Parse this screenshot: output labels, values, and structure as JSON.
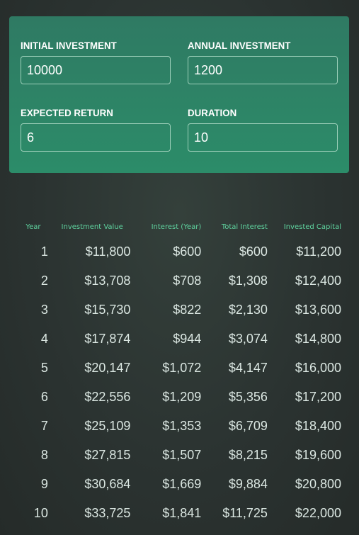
{
  "inputs": {
    "initial_investment": {
      "label": "INITIAL INVESTMENT",
      "value": "10000"
    },
    "annual_investment": {
      "label": "ANNUAL INVESTMENT",
      "value": "1200"
    },
    "expected_return": {
      "label": "EXPECTED RETURN",
      "value": "6"
    },
    "duration": {
      "label": "DURATION",
      "value": "10"
    }
  },
  "table": {
    "headers": [
      "Year",
      "Investment Value",
      "Interest (Year)",
      "Total Interest",
      "Invested Capital"
    ],
    "rows": [
      [
        "1",
        "$11,800",
        "$600",
        "$600",
        "$11,200"
      ],
      [
        "2",
        "$13,708",
        "$708",
        "$1,308",
        "$12,400"
      ],
      [
        "3",
        "$15,730",
        "$822",
        "$2,130",
        "$13,600"
      ],
      [
        "4",
        "$17,874",
        "$944",
        "$3,074",
        "$14,800"
      ],
      [
        "5",
        "$20,147",
        "$1,072",
        "$4,147",
        "$16,000"
      ],
      [
        "6",
        "$22,556",
        "$1,209",
        "$5,356",
        "$17,200"
      ],
      [
        "7",
        "$25,109",
        "$1,353",
        "$6,709",
        "$18,400"
      ],
      [
        "8",
        "$27,815",
        "$1,507",
        "$8,215",
        "$19,600"
      ],
      [
        "9",
        "$30,684",
        "$1,669",
        "$9,884",
        "$20,800"
      ],
      [
        "10",
        "$33,725",
        "$1,841",
        "$11,725",
        "$22,000"
      ]
    ]
  },
  "colors": {
    "panel": "#2c8c69",
    "header_text": "#5fd39f",
    "cell_text": "#dbe7e2",
    "background": "#2b3331"
  }
}
